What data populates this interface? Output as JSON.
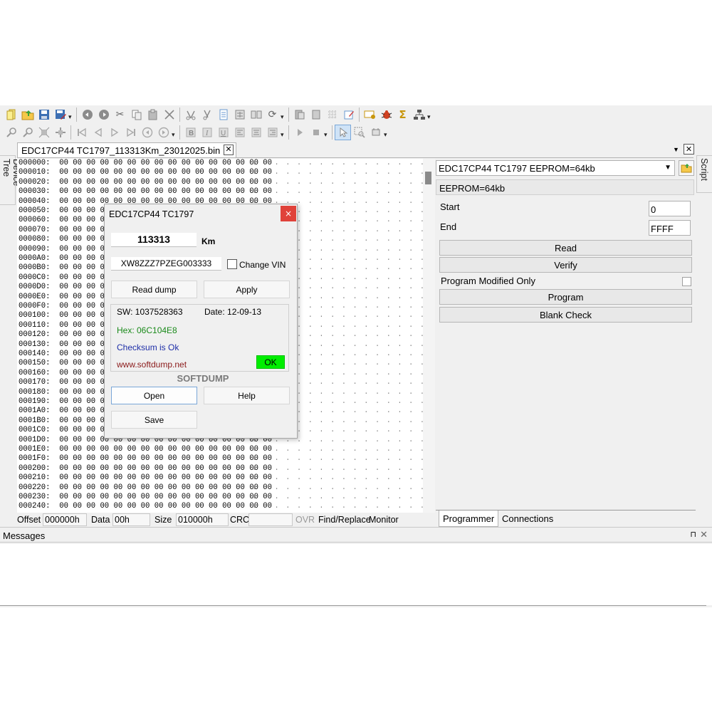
{
  "document_tab": {
    "title": "EDC17CP44 TC1797_113313Km_23012025.bin"
  },
  "side_tabs": {
    "left": "Device Tree",
    "right": "Script"
  },
  "hex_view": {
    "rows": [
      "000000:",
      "000010:",
      "000020:",
      "000030:",
      "000040:",
      "000050:",
      "000060:",
      "000070:",
      "000080:",
      "000090:",
      "0000A0:",
      "0000B0:",
      "0000C0:",
      "0000D0:",
      "0000E0:",
      "0000F0:",
      "000100:",
      "000110:",
      "000120:",
      "000130:",
      "000140:",
      "000150:",
      "000160:",
      "000170:",
      "000180:",
      "000190:",
      "0001A0:",
      "0001B0:",
      "0001C0:",
      "0001D0:",
      "0001E0:",
      "0001F0:",
      "000200:",
      "000210:",
      "000220:",
      "000230:",
      "000240:"
    ],
    "byte_value": "00",
    "ascii_placeholder": "."
  },
  "status_bar": {
    "offset_label": "Offset",
    "offset_value": "000000h",
    "data_label": "Data",
    "data_value": "00h",
    "size_label": "Size",
    "size_value": "010000h",
    "crc_label": "CRC",
    "crc_value": "",
    "ovr": "OVR",
    "find_replace": "Find/Replace",
    "monitor": "Monitor"
  },
  "programmer": {
    "device_combo": "EDC17CP44 TC1797 EEPROM=64kb",
    "info": "EEPROM=64kb",
    "start_label": "Start",
    "start_value": "0",
    "end_label": "End",
    "end_value": "FFFF",
    "read_button": "Read",
    "verify_button": "Verify",
    "modified_only_label": "Program Modified Only",
    "program_button": "Program",
    "blank_check_button": "Blank Check",
    "tabs": [
      "Programmer",
      "Connections"
    ]
  },
  "messages": {
    "title": "Messages"
  },
  "dialog": {
    "title": "EDC17CP44 TC1797",
    "close": "×",
    "km_value": "113313",
    "km_unit": "Km",
    "vin": "XW8ZZZ7PZEG003333",
    "change_vin": "Change VIN",
    "read_dump": "Read dump",
    "apply": "Apply",
    "sw": "SW: 1037528363",
    "date": "Date: 12-09-13",
    "hex": "Hex: 06C104E8",
    "checksum": "Checksum is Ok",
    "website": "www.softdump.net",
    "ok_badge": "OK",
    "brand": "SOFTDUMP",
    "open": "Open",
    "help": "Help",
    "save": "Save",
    "colors": {
      "hex": "#1a8a1a",
      "checksum": "#1f2fa8",
      "website": "#8b1a1a",
      "ok": "#00ee00",
      "close": "#e0423a"
    }
  },
  "icons": {
    "toolbar1": [
      "new-file-icon",
      "open-folder-icon",
      "save-icon",
      "save-as-icon",
      "separator",
      "undo-icon",
      "redo-icon",
      "cut-icon",
      "copy-icon",
      "paste-icon",
      "delete-icon",
      "separator",
      "find-icon",
      "find-replace-icon",
      "page-icon",
      "calculator-icon",
      "compare-icon",
      "refresh-icon",
      "separator",
      "copy-block-icon",
      "paste-block-icon",
      "grid-icon",
      "edit-icon",
      "separator",
      "tools-icon",
      "bug-icon",
      "sigma-icon",
      "network-icon"
    ],
    "toolbar2": [
      "zoom-in-icon",
      "zoom-out-icon",
      "fit-icon",
      "move-icon",
      "separator",
      "first-icon",
      "prev-icon",
      "next-icon",
      "last-icon",
      "back-circle-icon",
      "forward-circle-icon",
      "separator",
      "bold-icon",
      "italic-icon",
      "underline-icon",
      "align-left-icon",
      "align-center-icon",
      "align-right-icon",
      "separator",
      "play-icon",
      "stop-icon",
      "separator",
      "pointer-icon",
      "zoom-select-icon",
      "crop-icon"
    ]
  }
}
